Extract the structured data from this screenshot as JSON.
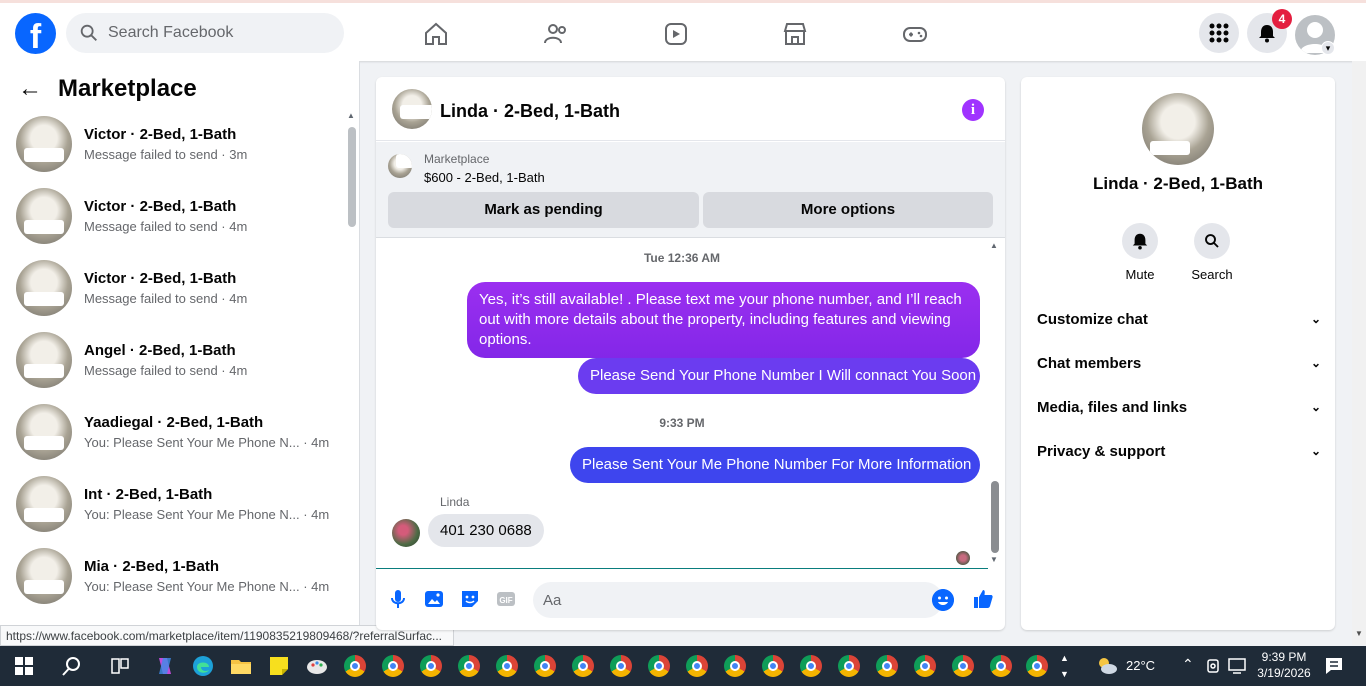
{
  "colors": {
    "facebook_blue": "#0866ff",
    "notification_red": "#e41e3f",
    "bubble_purple": "#8a2be2",
    "bubble_blue": "#3e45ee",
    "info_purple": "#a033ff"
  },
  "topnav": {
    "logo_letter": "f",
    "search_placeholder": "Search Facebook",
    "nav_icons": [
      "home-icon",
      "friends-icon",
      "video-icon",
      "marketplace-icon",
      "gaming-icon"
    ],
    "notification_count": "4"
  },
  "sidebar": {
    "title": "Marketplace",
    "conversations": [
      {
        "name": "Victor · 2-Bed, 1-Bath",
        "preview": "Message failed to send · 3m"
      },
      {
        "name": "Victor · 2-Bed, 1-Bath",
        "preview": "Message failed to send · 4m"
      },
      {
        "name": "Victor · 2-Bed, 1-Bath",
        "preview": "Message failed to send · 4m"
      },
      {
        "name": "Angel · 2-Bed, 1-Bath",
        "preview": "Message failed to send · 4m"
      },
      {
        "name": "Yaadiegal · 2-Bed, 1-Bath",
        "preview": "You: Please Sent Your Me Phone N... · 4m"
      },
      {
        "name": "Int · 2-Bed, 1-Bath",
        "preview": "You: Please Sent Your Me Phone N... · 4m"
      },
      {
        "name": "Mia · 2-Bed, 1-Bath",
        "preview": "You: Please Sent Your Me Phone N... · 4m"
      }
    ]
  },
  "status_url": "https://www.facebook.com/marketplace/item/1190835219809468/?referralSurfac...",
  "chat": {
    "title": "Linda · 2-Bed, 1-Bath",
    "listing": {
      "source": "Marketplace",
      "title": "$600 - 2-Bed, 1-Bath",
      "btn_pending": "Mark as pending",
      "btn_more": "More options"
    },
    "timestamp_1": "Tue 12:36 AM",
    "msg_1": "Yes, it’s still available! . Please text me your phone number, and I’ll reach out with more details about the property, including features and viewing options.",
    "msg_2": "Please Send Your Phone Number I Will connact You Soon",
    "timestamp_2": "9:33 PM",
    "msg_3": "Please Sent Your Me Phone Number For More Information",
    "incoming_sender": "Linda",
    "incoming_msg": "401 230 0688",
    "composer_placeholder": "Aa"
  },
  "details": {
    "name": "Linda · 2-Bed, 1-Bath",
    "mute_label": "Mute",
    "search_label": "Search",
    "sections": [
      "Customize chat",
      "Chat members",
      "Media, files and links",
      "Privacy & support"
    ]
  },
  "taskbar": {
    "temperature": "22°C",
    "time": "9:39 PM",
    "date": "3/19/2026"
  }
}
